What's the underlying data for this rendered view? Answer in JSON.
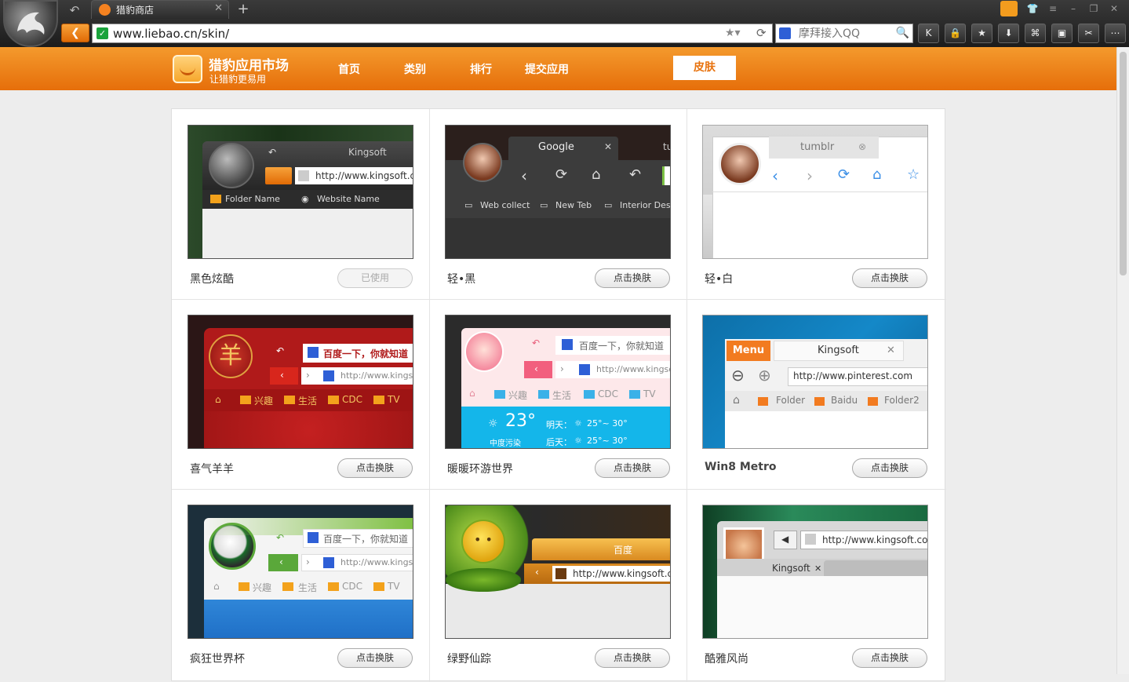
{
  "browser": {
    "tab_title": "猎豹商店",
    "address": "www.liebao.cn/skin/",
    "search_placeholder": "摩拜接入QQ"
  },
  "site": {
    "title": "猎豹应用市场",
    "slogan": "让猎豹更易用",
    "nav": [
      "首页",
      "类别",
      "排行",
      "提交应用"
    ],
    "skin_button": "皮肤"
  },
  "skins": [
    {
      "name": "黑色炫酷",
      "button": "已使用"
    },
    {
      "name": "轻•黑",
      "button": "点击换肤"
    },
    {
      "name": "轻•白",
      "button": "点击换肤"
    },
    {
      "name": "喜气羊羊",
      "button": "点击换肤"
    },
    {
      "name": "暖暖环游世界",
      "button": "点击换肤"
    },
    {
      "name": "Win8 Metro",
      "button": "点击换肤"
    },
    {
      "name": "疯狂世界杯",
      "button": "点击换肤"
    },
    {
      "name": "绿野仙踪",
      "button": "点击换肤"
    },
    {
      "name": "酷雅风尚",
      "button": "点击换肤"
    }
  ],
  "previews": {
    "kingsoft": {
      "tab": "Kingsoft",
      "url": "http://www.kingsoft.cc",
      "folder": "Folder Name",
      "website": "Website Name"
    },
    "light_black": {
      "tab": "Google",
      "tab2": "tu",
      "bm1": "Web collect",
      "bm2": "New Teb",
      "bm3": "Interior Desig"
    },
    "light_white": {
      "tab": "tumblr"
    },
    "sheep": {
      "search": "百度一下，你就知道",
      "url": "http://www.kings",
      "b1": "兴趣",
      "b2": "生活",
      "b3": "CDC",
      "b4": "TV"
    },
    "travel": {
      "search": "百度一下，你就知道",
      "url": "http://www.kingsc",
      "b1": "兴趣",
      "b2": "生活",
      "b3": "CDC",
      "b4": "TV",
      "temp": "23°",
      "pollution": "中度污染",
      "tomorrow": "明天：",
      "after": "后天：",
      "range1": "25°~ 30°",
      "range2": "25°~ 30°"
    },
    "metro": {
      "menu": "Menu",
      "tab": "Kingsoft",
      "url": "http://www.pinterest.com",
      "f1": "Folder",
      "f2": "Baidu",
      "f3": "Folder2"
    },
    "worldcup": {
      "search": "百度一下，你就知道",
      "url": "http://www.kings",
      "b1": "兴趣",
      "b2": "生活",
      "b3": "CDC",
      "b4": "TV"
    },
    "forest": {
      "tab": "百度",
      "url": "http://www.kingsoft.cc"
    },
    "elegant": {
      "url": "http://www.kingsoft.com",
      "tab": "Kingsoft"
    }
  }
}
